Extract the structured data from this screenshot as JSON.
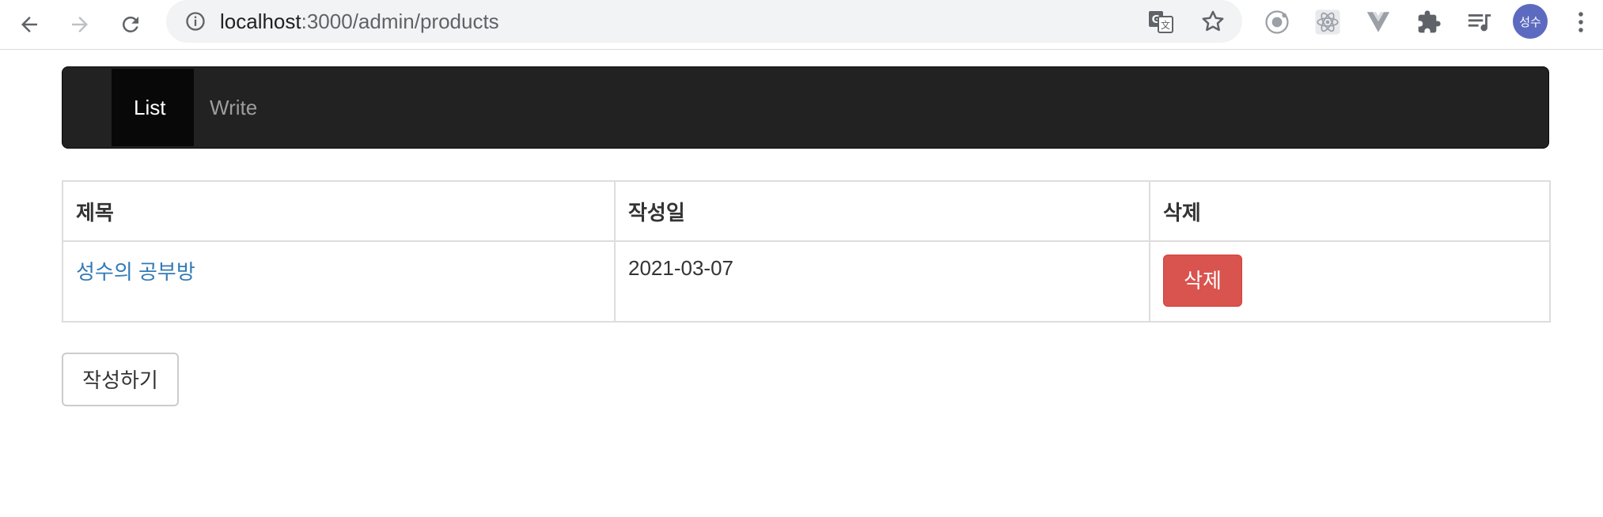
{
  "browser": {
    "url_host": "localhost",
    "url_path": ":3000/admin/products",
    "profile_initials": "성수",
    "extensions": [
      "ionic-icon",
      "react-devtools-icon",
      "vue-devtools-icon",
      "extensions-puzzle-icon",
      "media-queue-icon"
    ]
  },
  "navbar": {
    "items": [
      {
        "label": "List",
        "active": true
      },
      {
        "label": "Write",
        "active": false
      }
    ]
  },
  "table": {
    "headers": [
      "제목",
      "작성일",
      "삭제"
    ],
    "rows": [
      {
        "title": "성수의 공부방",
        "date": "2021-03-07",
        "delete_label": "삭제"
      }
    ]
  },
  "actions": {
    "write_label": "작성하기"
  },
  "colors": {
    "navbar_bg": "#222222",
    "link": "#337ab7",
    "danger": "#d9534f"
  }
}
